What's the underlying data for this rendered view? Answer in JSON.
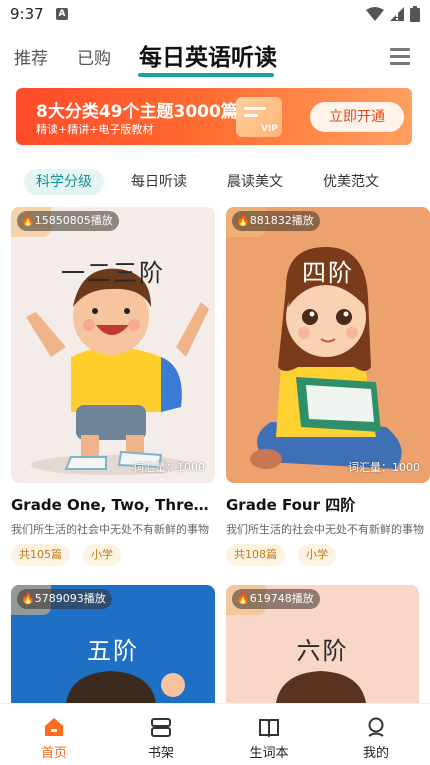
{
  "status": {
    "time": "9:37",
    "a_icon": "A"
  },
  "nav": {
    "tabs": [
      {
        "label": "推荐"
      },
      {
        "label": "已购"
      },
      {
        "label": "每日英语听读"
      }
    ]
  },
  "banner": {
    "title": "8大分类49个主题3000篇",
    "subtitle": "精读+精讲+电子版教材",
    "vip_text": "VIP",
    "button": "立即开通"
  },
  "categories": [
    "科学分级",
    "每日听读",
    "晨读美文",
    "优美范文"
  ],
  "cards": [
    {
      "plays": "15850805播放",
      "cover_title": "一二三阶",
      "vocab": "词汇量：1000",
      "title": "Grade One, Two, Three 一二三阶",
      "desc": "我们所生活的社会中无处不有新鲜的事物",
      "tag1": "共105篇",
      "tag2": "小学"
    },
    {
      "plays": "881832播放",
      "cover_title": "四阶",
      "vocab": "词汇量：1000",
      "title": "Grade Four 四阶",
      "desc": "我们所生活的社会中无处不有新鲜的事物",
      "tag1": "共108篇",
      "tag2": "小学"
    },
    {
      "plays": "5789093播放",
      "cover_title": "五阶"
    },
    {
      "plays": "619748播放",
      "cover_title": "六阶"
    }
  ],
  "bottom_nav": [
    {
      "label": "首页"
    },
    {
      "label": "书架"
    },
    {
      "label": "生词本"
    },
    {
      "label": "我的"
    }
  ],
  "colors": {
    "accent": "#1aa3a3",
    "active_tab": "#ff6a1f",
    "banner": "#ff5a2c"
  }
}
